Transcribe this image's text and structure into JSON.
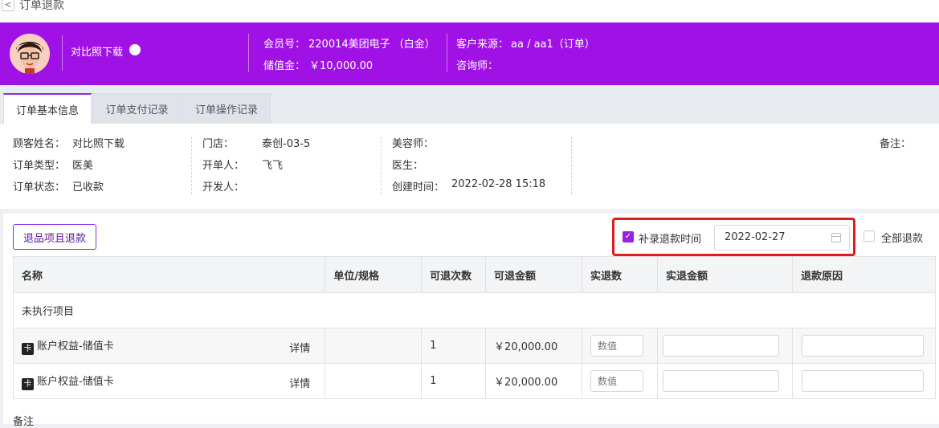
{
  "page": {
    "title": "订单退款",
    "back_symbol": "<"
  },
  "header": {
    "customer_name": "对比照下载",
    "member_label": "会员号：",
    "member_value": "220014美团电子 （白金）",
    "balance_label": "储值金：",
    "balance_value": "￥10,000.00",
    "source_label": "客户来源：",
    "source_value": "aa / aa1（订单）",
    "consultant_label": "咨询师：",
    "accent_color": "#a011e6"
  },
  "tabs": [
    {
      "label": "订单基本信息",
      "active": true
    },
    {
      "label": "订单支付记录",
      "active": false
    },
    {
      "label": "订单操作记录",
      "active": false
    }
  ],
  "info": {
    "customer_label": "顾客姓名：",
    "customer_value": "对比照下载",
    "order_type_label": "订单类型：",
    "order_type_value": "医美",
    "order_status_label": "订单状态：",
    "order_status_value": "已收款",
    "store_label": "门店：",
    "store_value": "泰创-03-5",
    "creator_label": "开单人：",
    "creator_value": "飞飞",
    "developer_label": "开发人：",
    "beautician_label": "美容师：",
    "doctor_label": "医生：",
    "created_label": "创建时间：",
    "created_value": "2022-02-28 15:18",
    "remark_label": "备注："
  },
  "refund": {
    "return_button": "退品项且退款",
    "backfill_label": "补录退款时间",
    "backfill_checked": true,
    "date_value": "2022-02-27",
    "all_refund_label": "全部退款",
    "all_refund_checked": false,
    "highlight_color": "#e21b1b"
  },
  "table": {
    "headers": [
      "名称",
      "单位/规格",
      "可退次数",
      "可退金额",
      "实退数",
      "实退金额",
      "退款原因"
    ],
    "group_label": "未执行项目",
    "rows": [
      {
        "card_badge": "卡",
        "name": "账户权益-储值卡",
        "detail": "详情",
        "unit": "",
        "count": "1",
        "amount": "￥20,000.00",
        "qty_placeholder": "数值"
      },
      {
        "card_badge": "卡",
        "name": "账户权益-储值卡",
        "detail": "详情",
        "unit": "",
        "count": "1",
        "amount": "￥20,000.00",
        "qty_placeholder": "数值"
      }
    ]
  },
  "footer": {
    "remark_label": "备注"
  }
}
